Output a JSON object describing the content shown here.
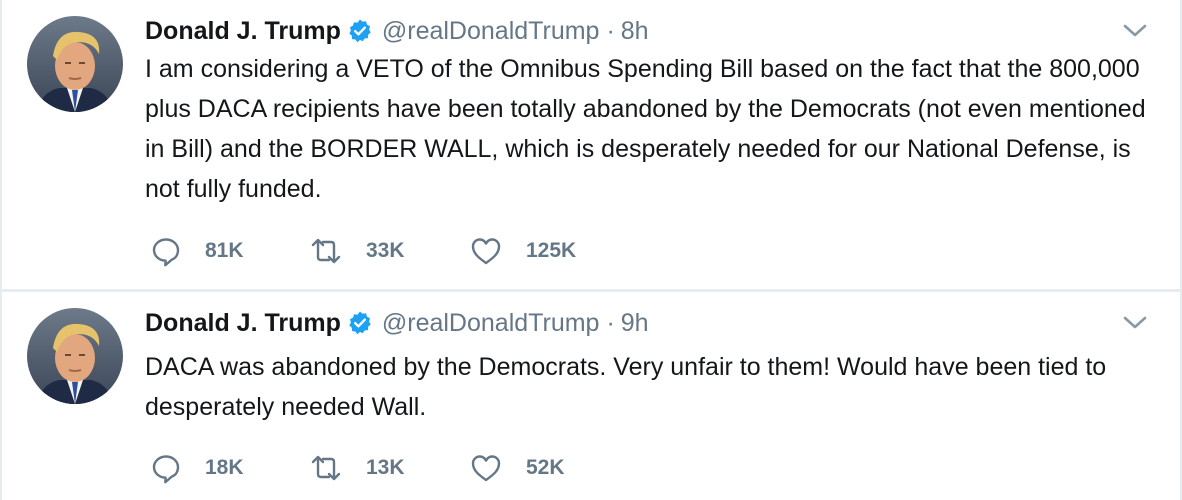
{
  "tweets": [
    {
      "fullname": "Donald J. Trump",
      "username": "@realDonaldTrump",
      "separator": "·",
      "time": "8h",
      "text": "I am considering a VETO of the Omnibus Spending Bill based on the fact that the 800,000 plus DACA recipients have been totally abandoned by the Democrats (not even mentioned in Bill) and the BORDER WALL, which is desperately needed for our National Defense, is not fully funded.",
      "replies": "81K",
      "retweets": "33K",
      "likes": "125K"
    },
    {
      "fullname": "Donald J. Trump",
      "username": "@realDonaldTrump",
      "separator": "·",
      "time": "9h",
      "text": "DACA was abandoned by the Democrats. Very unfair to them! Would have been tied to desperately needed Wall.",
      "replies": "18K",
      "retweets": "13K",
      "likes": "52K"
    }
  ],
  "colors": {
    "background": "#e6ecf0",
    "card": "#ffffff",
    "text": "#14171a",
    "muted": "#657786",
    "verified": "#1da1f2"
  },
  "icons": {
    "verified": "verified-badge-icon",
    "menu": "chevron-down-icon",
    "reply": "reply-icon",
    "retweet": "retweet-icon",
    "like": "heart-icon",
    "avatar": "profile-photo"
  }
}
